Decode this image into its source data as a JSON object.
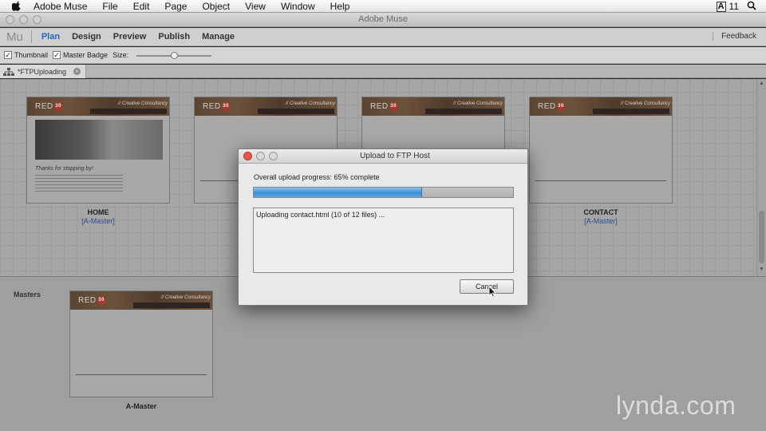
{
  "menubar": {
    "app_name": "Adobe Muse",
    "items": [
      "File",
      "Edit",
      "Page",
      "Object",
      "View",
      "Window",
      "Help"
    ],
    "status_badge": "A",
    "status_text": "11"
  },
  "window": {
    "title": "Adobe Muse"
  },
  "nav": {
    "logo": "Mu",
    "items": [
      "Plan",
      "Design",
      "Preview",
      "Publish",
      "Manage"
    ],
    "active": "Plan",
    "feedback": "Feedback"
  },
  "options": {
    "thumbnail_label": "Thumbnail",
    "thumbnail_checked": true,
    "master_badge_label": "Master Badge",
    "master_badge_checked": true,
    "size_label": "Size:",
    "size_value": 0.5
  },
  "tab": {
    "label": "*FTPUploading"
  },
  "plan": {
    "pages": [
      {
        "name": "HOME",
        "master": "[A-Master]"
      },
      {
        "name": "",
        "master": ""
      },
      {
        "name": "",
        "master": ""
      },
      {
        "name": "CONTACT",
        "master": "[A-Master]"
      }
    ],
    "thumbnail": {
      "brand": "RED",
      "brand_badge": "30",
      "tagline": "// Creative Consultancy",
      "home_heading": "Thanks for stopping by!"
    },
    "masters_label": "Masters",
    "master_page": {
      "name": "A-Master"
    }
  },
  "dialog": {
    "title": "Upload to FTP Host",
    "progress_label": "Overall upload progress: 65% complete",
    "progress": 0.65,
    "log_text": "Uploading contact.html (10 of 12 files) ...",
    "cancel_label": "Cancel"
  },
  "watermark": "lynda.com"
}
